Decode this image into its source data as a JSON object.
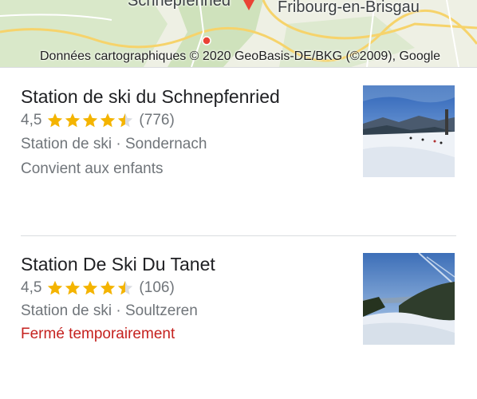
{
  "map": {
    "place_label": "Schnepfenried",
    "city_label": "Fribourg-en-Brisgau",
    "credit": "Données cartographiques © 2020 GeoBasis-DE/BKG (©2009), Google"
  },
  "results": [
    {
      "title": "Station de ski du Schnepfenried",
      "rating": "4,5",
      "stars_value": 4.5,
      "reviews": "(776)",
      "meta": "Station de ski · Sondernach",
      "extra": "Convient aux enfants",
      "extra_color": "#70757a",
      "thumb_icon": "ski-slope-photo"
    },
    {
      "title": "Station De Ski Du Tanet",
      "rating": "4,5",
      "stars_value": 4.5,
      "reviews": "(106)",
      "meta": "Station de ski · Soultzeren",
      "extra": "Fermé temporairement",
      "extra_color": "#c5221f",
      "thumb_icon": "ski-slope-photo"
    }
  ],
  "colors": {
    "star": "#f4b400",
    "star_empty": "#dadce0",
    "closed_text": "#c5221f"
  }
}
